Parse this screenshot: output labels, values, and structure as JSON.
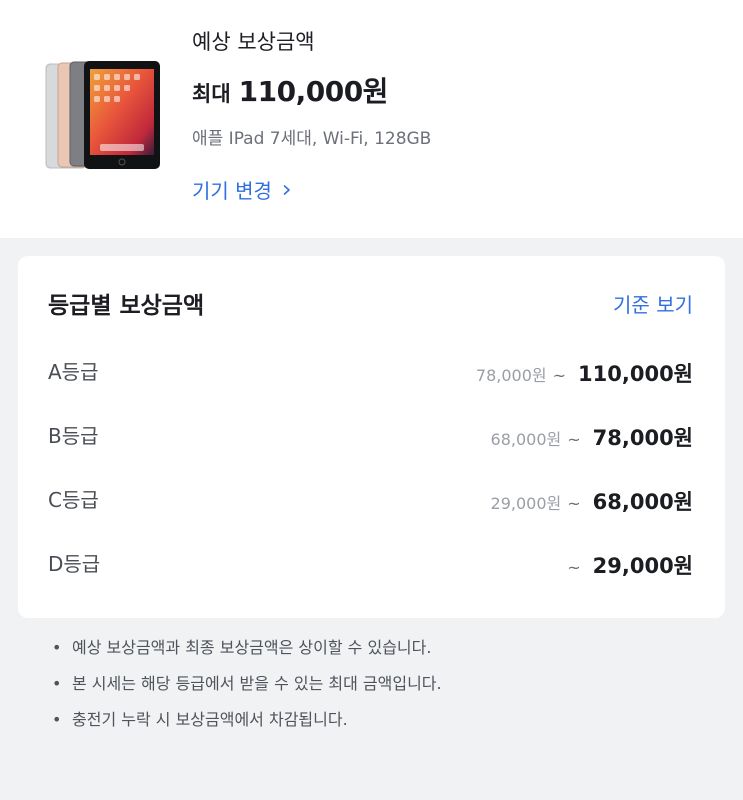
{
  "header": {
    "estimate_label": "예상 보상금액",
    "max_prefix": "최대",
    "max_value": "110,000원",
    "device_model": "애플 IPad 7세대, Wi-Fi, 128GB",
    "change_device": "기기 변경"
  },
  "grades_card": {
    "title": "등급별 보상금액",
    "criteria_link": "기준 보기",
    "grades": [
      {
        "name": "A등급",
        "min": "78,000원",
        "tilde": "~",
        "max": "110,000원"
      },
      {
        "name": "B등급",
        "min": "68,000원",
        "tilde": "~",
        "max": "78,000원"
      },
      {
        "name": "C등급",
        "min": "29,000원",
        "tilde": "~",
        "max": "68,000원"
      },
      {
        "name": "D등급",
        "min": "",
        "tilde": "~",
        "max": "29,000원"
      }
    ]
  },
  "notes": [
    "예상 보상금액과 최종 보상금액은 상이할 수 있습니다.",
    "본 시세는 해당 등급에서 받을 수 있는 최대 금액입니다.",
    "충전기 누락 시 보상금액에서 차감됩니다."
  ],
  "colors": {
    "link": "#3270e0",
    "background": "#f1f2f4"
  }
}
